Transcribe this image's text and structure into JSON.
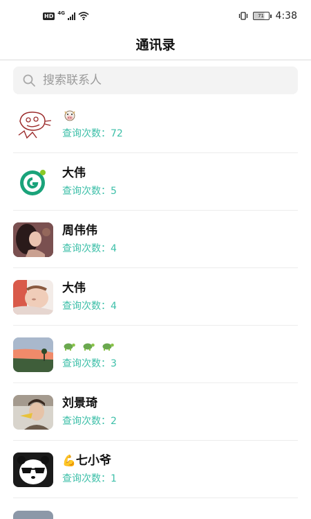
{
  "status_bar": {
    "hd": "HD",
    "network": "4G",
    "battery": "71",
    "time": "4:38"
  },
  "header": {
    "title": "通讯录"
  },
  "search": {
    "placeholder": "搜索联系人"
  },
  "contacts": [
    {
      "name": "",
      "name_icon": "cow-emoji",
      "count_label": "查询次数：",
      "count": "72",
      "avatar": "hand-drawn-face-avatar"
    },
    {
      "name": "大伟",
      "count_label": "查询次数：",
      "count": "5",
      "avatar": "green-g-logo-avatar"
    },
    {
      "name": "周伟伟",
      "count_label": "查询次数：",
      "count": "4",
      "avatar": "portrait-photo-avatar"
    },
    {
      "name": "大伟",
      "count_label": "查询次数：",
      "count": "4",
      "avatar": "baby-photo-avatar"
    },
    {
      "name": "",
      "name_icon": "turtle-emoji",
      "count_label": "查询次数：",
      "count": "3",
      "avatar": "sunset-photo-avatar"
    },
    {
      "name": "刘景琦",
      "count_label": "查询次数：",
      "count": "2",
      "avatar": "person-photo-avatar"
    },
    {
      "name": "七小爷",
      "name_prefix_icon": "flexed-biceps-emoji",
      "count_label": "查询次数：",
      "count": "1",
      "avatar": "panda-sunglasses-avatar"
    }
  ],
  "colors": {
    "accent_teal": "#3cbfa8",
    "search_bg": "#f3f3f3",
    "divider": "#ececec"
  }
}
